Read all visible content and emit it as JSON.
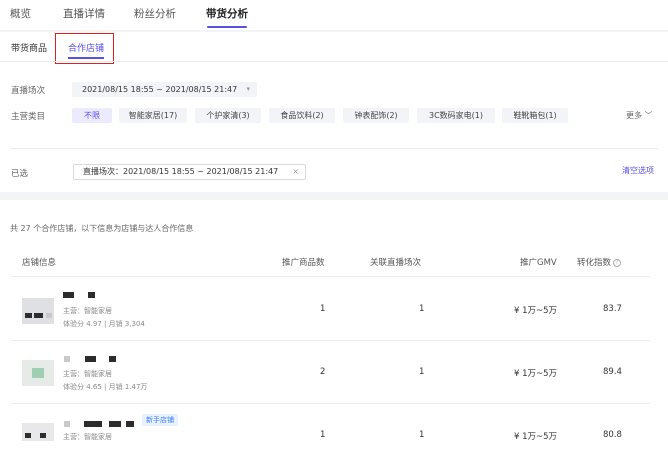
{
  "top_tabs": [
    "概览",
    "直播详情",
    "粉丝分析",
    "带货分析"
  ],
  "sub_tabs": [
    "带货商品",
    "合作店铺"
  ],
  "filters": {
    "session_label": "直播场次",
    "session_value": "2021/08/15 18:55 ~ 2021/08/15 21:47",
    "category_label": "主营类目",
    "categories": [
      "不限",
      "智能家居(17)",
      "个护家清(3)",
      "食品饮料(2)",
      "钟表配饰(2)",
      "3C数码家电(1)",
      "鞋靴箱包(1)"
    ],
    "more": "更多",
    "selected_label": "已选",
    "selected_chip": "直播场次：2021/08/15 18:55 ~ 2021/08/15 21:47",
    "clear": "清空选项"
  },
  "summary": "共 27 个合作店铺，以下信息为店铺与达人合作信息",
  "table": {
    "headers": [
      "店铺信息",
      "推广商品数",
      "关联直播场次",
      "推广GMV",
      "转化指数"
    ],
    "rows": [
      {
        "main": "主营：智能家居",
        "stats": "体验分 4.97 | 月销 3,304",
        "products": "1",
        "sessions": "1",
        "gmv": "¥ 1万~5万",
        "index": "83.7"
      },
      {
        "main": "主营：智能家居",
        "stats": "体验分 4.65 | 月销 1.47万",
        "products": "2",
        "sessions": "1",
        "gmv": "¥ 1万~5万",
        "index": "89.4"
      },
      {
        "main": "主营：智能家居",
        "badge": "新手店铺",
        "products": "1",
        "sessions": "1",
        "gmv": "¥ 1万~5万",
        "index": "80.8"
      }
    ]
  }
}
